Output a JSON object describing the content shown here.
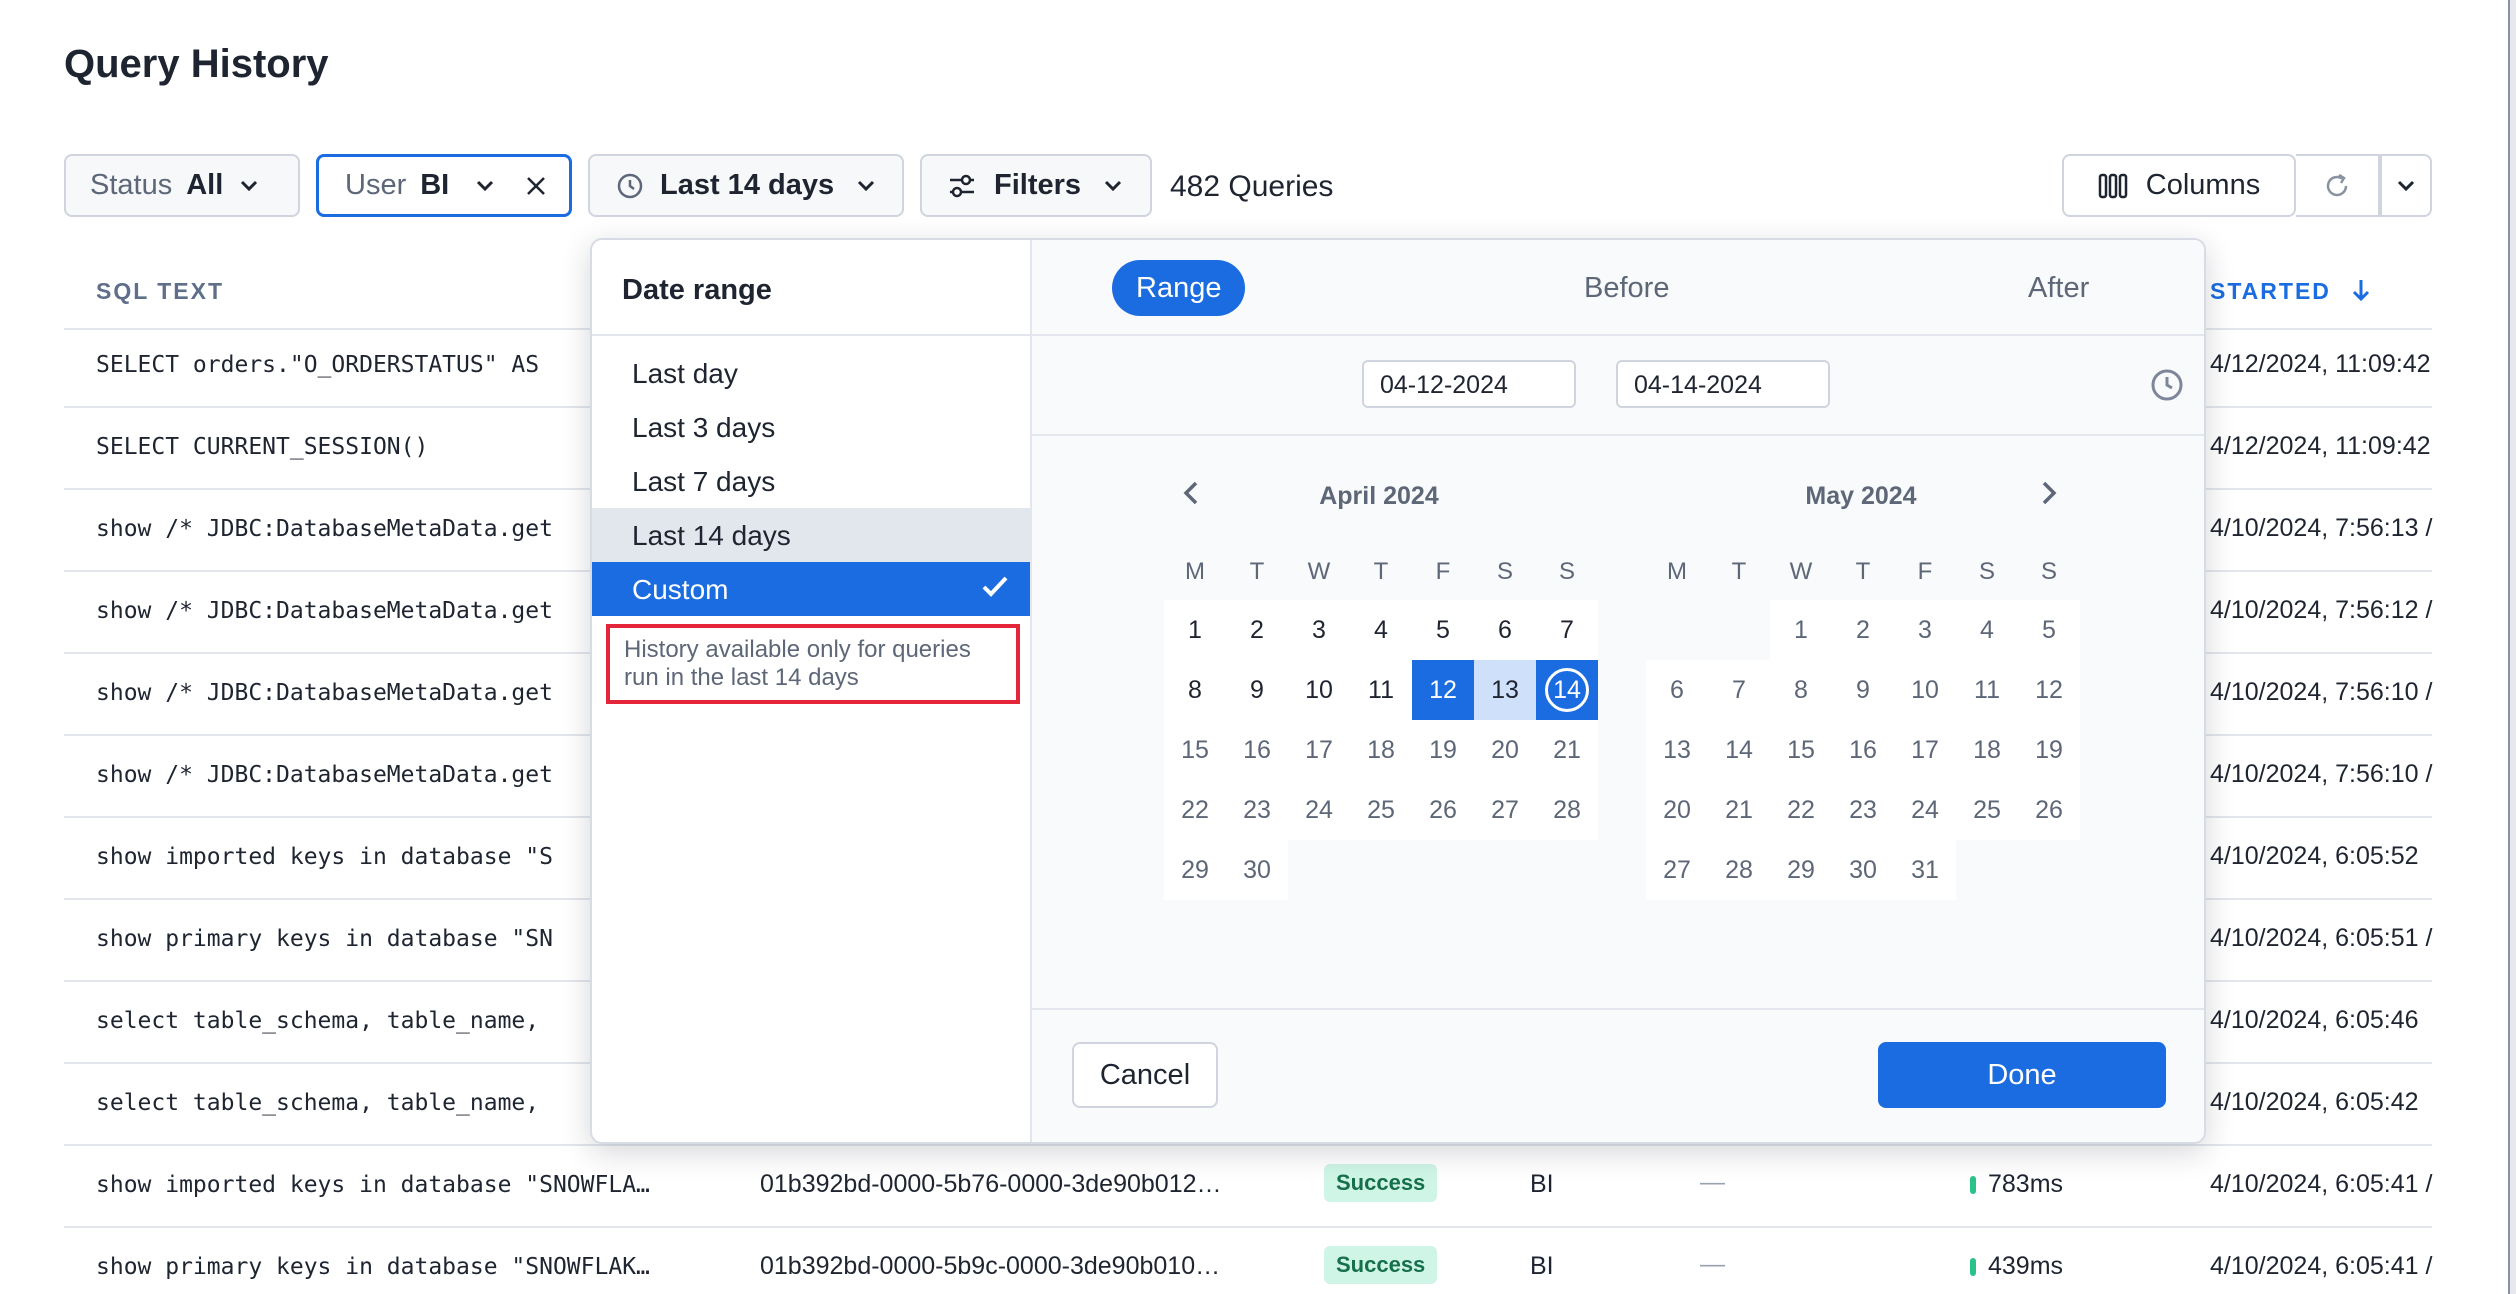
{
  "page_title": "Query History",
  "toolbar": {
    "status_label": "Status",
    "status_value": "All",
    "user_label": "User",
    "user_value": "BI",
    "time_value": "Last 14 days",
    "filters_label": "Filters",
    "query_count": "482 Queries",
    "columns_label": "Columns"
  },
  "table": {
    "col_sql": "SQL TEXT",
    "col_started": "STARTED",
    "rows": [
      {
        "sql": "SELECT orders.\"O_ORDERSTATUS\" AS",
        "started": "4/12/2024, 11:09:42"
      },
      {
        "sql": "SELECT CURRENT_SESSION()",
        "started": "4/12/2024, 11:09:42"
      },
      {
        "sql": "show /* JDBC:DatabaseMetaData.get",
        "started": "4/10/2024, 7:56:13 /"
      },
      {
        "sql": "show /* JDBC:DatabaseMetaData.get",
        "started": "4/10/2024, 7:56:12 /"
      },
      {
        "sql": "show /* JDBC:DatabaseMetaData.get",
        "started": "4/10/2024, 7:56:10 /"
      },
      {
        "sql": "show /* JDBC:DatabaseMetaData.get",
        "started": "4/10/2024, 7:56:10 /"
      },
      {
        "sql": "show imported keys in database \"S",
        "started": "4/10/2024, 6:05:52"
      },
      {
        "sql": "show primary keys in database \"SN",
        "started": "4/10/2024, 6:05:51 /"
      },
      {
        "sql": "select table_schema, table_name,",
        "started": "4/10/2024, 6:05:46"
      },
      {
        "sql": "select table_schema, table_name,",
        "started": "4/10/2024, 6:05:42"
      },
      {
        "sql": "show imported keys in database \"SNOWFLA…",
        "query_id": "01b392bd-0000-5b76-0000-3de90b012…",
        "status": "Success",
        "user": "BI",
        "dash": "—",
        "duration": "783ms",
        "started": "4/10/2024, 6:05:41 /"
      },
      {
        "sql": "show primary keys in database \"SNOWFLAK…",
        "query_id": "01b392bd-0000-5b9c-0000-3de90b010…",
        "status": "Success",
        "user": "BI",
        "dash": "—",
        "duration": "439ms",
        "started": "4/10/2024, 6:05:41 /"
      }
    ]
  },
  "popup": {
    "title": "Date range",
    "presets": [
      "Last day",
      "Last 3 days",
      "Last 7 days",
      "Last 14 days",
      "Custom"
    ],
    "note": "History available only for queries run in the last 14 days",
    "modes": [
      "Range",
      "Before",
      "After"
    ],
    "start_date": "04-12-2024",
    "end_date": "04-14-2024",
    "month1": "April 2024",
    "month2": "May 2024",
    "weekdays": [
      "M",
      "T",
      "W",
      "T",
      "F",
      "S",
      "S"
    ],
    "cancel": "Cancel",
    "done": "Done"
  },
  "colors": {
    "accent": "#1a6ce0",
    "highlight": "#e5253a",
    "success_bg": "#cff5e6"
  }
}
